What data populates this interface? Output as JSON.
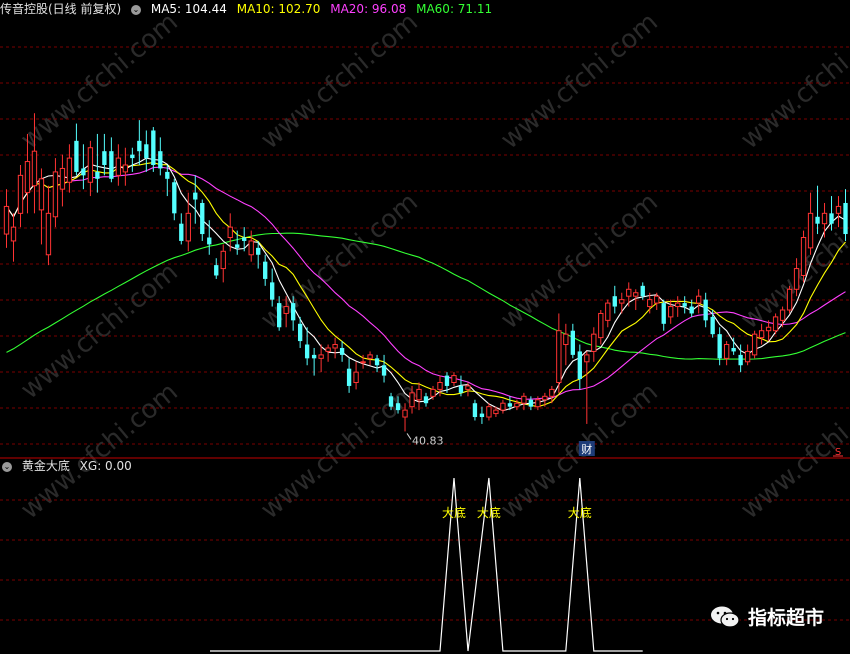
{
  "header": {
    "title": "传音控股(日线 前复权)",
    "ma5": "MA5: 104.44",
    "ma10": "MA10: 102.70",
    "ma20": "MA20: 96.08",
    "ma60": "MA60: 71.11",
    "colors": {
      "ma5": "#ffffff",
      "ma10": "#ffff00",
      "ma20": "#ff40ff",
      "ma60": "#33ff33"
    }
  },
  "sub_header": {
    "title": "黄金大底",
    "xg": "XG: 0.00"
  },
  "low_label": "40.83",
  "finance_marker": "财",
  "s_marker": "S",
  "signal_label": "大底",
  "brand": "指标超市",
  "watermark": "www.cfchi.com",
  "chart_data": [
    {
      "type": "candlestick",
      "ylim": [
        34,
        160
      ],
      "up_color": "#ff3333",
      "down_color": "#54ffff",
      "candles": [
        {
          "o": 98,
          "h": 111,
          "l": 94,
          "c": 106
        },
        {
          "o": 96,
          "h": 104,
          "l": 90,
          "c": 100
        },
        {
          "o": 104,
          "h": 118,
          "l": 100,
          "c": 115
        },
        {
          "o": 110,
          "h": 127,
          "l": 104,
          "c": 119
        },
        {
          "o": 112,
          "h": 133,
          "l": 104,
          "c": 122
        },
        {
          "o": 105,
          "h": 117,
          "l": 95,
          "c": 114
        },
        {
          "o": 92,
          "h": 112,
          "l": 89,
          "c": 104
        },
        {
          "o": 103,
          "h": 120,
          "l": 100,
          "c": 116
        },
        {
          "o": 111,
          "h": 121,
          "l": 106,
          "c": 117
        },
        {
          "o": 113,
          "h": 124,
          "l": 110,
          "c": 120
        },
        {
          "o": 125,
          "h": 130,
          "l": 115,
          "c": 116
        },
        {
          "o": 117,
          "h": 124,
          "l": 111,
          "c": 115
        },
        {
          "o": 113,
          "h": 125,
          "l": 109,
          "c": 123
        },
        {
          "o": 116,
          "h": 127,
          "l": 110,
          "c": 114
        },
        {
          "o": 122,
          "h": 127,
          "l": 115,
          "c": 118
        },
        {
          "o": 122,
          "h": 126,
          "l": 113,
          "c": 114
        },
        {
          "o": 115,
          "h": 124,
          "l": 112,
          "c": 120
        },
        {
          "o": 116,
          "h": 123,
          "l": 112,
          "c": 118
        },
        {
          "o": 121,
          "h": 123,
          "l": 116,
          "c": 120
        },
        {
          "o": 125,
          "h": 131,
          "l": 118,
          "c": 122
        },
        {
          "o": 124,
          "h": 128,
          "l": 116,
          "c": 120
        },
        {
          "o": 128,
          "h": 129,
          "l": 116,
          "c": 118
        },
        {
          "o": 122,
          "h": 126,
          "l": 115,
          "c": 117
        },
        {
          "o": 116,
          "h": 118,
          "l": 109,
          "c": 114
        },
        {
          "o": 113,
          "h": 114,
          "l": 102,
          "c": 104
        },
        {
          "o": 101,
          "h": 104,
          "l": 95,
          "c": 96
        },
        {
          "o": 96,
          "h": 110,
          "l": 93,
          "c": 104
        },
        {
          "o": 110,
          "h": 115,
          "l": 101,
          "c": 108
        },
        {
          "o": 107,
          "h": 108,
          "l": 96,
          "c": 98
        },
        {
          "o": 97,
          "h": 102,
          "l": 92,
          "c": 95
        },
        {
          "o": 89,
          "h": 91,
          "l": 85,
          "c": 86
        },
        {
          "o": 88,
          "h": 95,
          "l": 84,
          "c": 93
        },
        {
          "o": 97,
          "h": 104,
          "l": 93,
          "c": 100
        },
        {
          "o": 95,
          "h": 99,
          "l": 92,
          "c": 94
        },
        {
          "o": 97,
          "h": 100,
          "l": 93,
          "c": 96
        },
        {
          "o": 92,
          "h": 99,
          "l": 90,
          "c": 96
        },
        {
          "o": 94,
          "h": 96,
          "l": 88,
          "c": 92
        },
        {
          "o": 90,
          "h": 92,
          "l": 83,
          "c": 85
        },
        {
          "o": 84,
          "h": 88,
          "l": 77,
          "c": 79
        },
        {
          "o": 78,
          "h": 80,
          "l": 70,
          "c": 71
        },
        {
          "o": 75,
          "h": 80,
          "l": 71,
          "c": 77
        },
        {
          "o": 78,
          "h": 80,
          "l": 70,
          "c": 73
        },
        {
          "o": 72,
          "h": 74,
          "l": 65,
          "c": 67
        },
        {
          "o": 66,
          "h": 71,
          "l": 60,
          "c": 62
        },
        {
          "o": 63,
          "h": 65,
          "l": 57,
          "c": 62
        },
        {
          "o": 62,
          "h": 66,
          "l": 58,
          "c": 63
        },
        {
          "o": 64,
          "h": 66,
          "l": 61,
          "c": 65
        },
        {
          "o": 65,
          "h": 68,
          "l": 62,
          "c": 66
        },
        {
          "o": 65,
          "h": 67,
          "l": 61,
          "c": 63
        },
        {
          "o": 59,
          "h": 62,
          "l": 52,
          "c": 54
        },
        {
          "o": 55,
          "h": 61,
          "l": 53,
          "c": 58
        },
        {
          "o": 61,
          "h": 63,
          "l": 59,
          "c": 61
        },
        {
          "o": 62,
          "h": 64,
          "l": 60,
          "c": 63
        },
        {
          "o": 62,
          "h": 63,
          "l": 58,
          "c": 60
        },
        {
          "o": 60,
          "h": 63,
          "l": 55,
          "c": 57
        },
        {
          "o": 51,
          "h": 52,
          "l": 47,
          "c": 48
        },
        {
          "o": 49,
          "h": 51,
          "l": 46,
          "c": 47
        },
        {
          "o": 45,
          "h": 49,
          "l": 40.83,
          "c": 47
        },
        {
          "o": 48,
          "h": 54,
          "l": 46,
          "c": 52
        },
        {
          "o": 50,
          "h": 55,
          "l": 47,
          "c": 53
        },
        {
          "o": 51,
          "h": 52,
          "l": 48,
          "c": 49
        },
        {
          "o": 51,
          "h": 54,
          "l": 50,
          "c": 53
        },
        {
          "o": 53,
          "h": 57,
          "l": 51,
          "c": 55
        },
        {
          "o": 57,
          "h": 58,
          "l": 52,
          "c": 54
        },
        {
          "o": 55,
          "h": 58,
          "l": 54,
          "c": 57
        },
        {
          "o": 54,
          "h": 57,
          "l": 51,
          "c": 52
        },
        {
          "o": 53,
          "h": 55,
          "l": 51,
          "c": 54
        },
        {
          "o": 49,
          "h": 50,
          "l": 44,
          "c": 45
        },
        {
          "o": 46,
          "h": 48,
          "l": 43,
          "c": 45
        },
        {
          "o": 45,
          "h": 49,
          "l": 44,
          "c": 48
        },
        {
          "o": 46,
          "h": 48,
          "l": 45,
          "c": 47
        },
        {
          "o": 47,
          "h": 50,
          "l": 46,
          "c": 49
        },
        {
          "o": 49,
          "h": 51,
          "l": 47,
          "c": 48
        },
        {
          "o": 48,
          "h": 50,
          "l": 47,
          "c": 49
        },
        {
          "o": 49,
          "h": 52,
          "l": 47,
          "c": 51
        },
        {
          "o": 50,
          "h": 51,
          "l": 47,
          "c": 48
        },
        {
          "o": 48,
          "h": 51,
          "l": 47,
          "c": 50
        },
        {
          "o": 50,
          "h": 52,
          "l": 48,
          "c": 51
        },
        {
          "o": 51,
          "h": 54,
          "l": 49,
          "c": 53
        },
        {
          "o": 55,
          "h": 75,
          "l": 52,
          "c": 70
        },
        {
          "o": 66,
          "h": 72,
          "l": 60,
          "c": 69
        },
        {
          "o": 70,
          "h": 72,
          "l": 62,
          "c": 63
        },
        {
          "o": 64,
          "h": 66,
          "l": 53,
          "c": 56
        },
        {
          "o": 61,
          "h": 64,
          "l": 43,
          "c": 63
        },
        {
          "o": 64,
          "h": 71,
          "l": 61,
          "c": 69
        },
        {
          "o": 68,
          "h": 76,
          "l": 66,
          "c": 75
        },
        {
          "o": 73,
          "h": 79,
          "l": 71,
          "c": 78
        },
        {
          "o": 80,
          "h": 83,
          "l": 75,
          "c": 77
        },
        {
          "o": 78,
          "h": 81,
          "l": 75,
          "c": 79
        },
        {
          "o": 80,
          "h": 84,
          "l": 77,
          "c": 82
        },
        {
          "o": 80,
          "h": 82,
          "l": 76,
          "c": 81
        },
        {
          "o": 83,
          "h": 84,
          "l": 79,
          "c": 80
        },
        {
          "o": 77,
          "h": 81,
          "l": 75,
          "c": 79
        },
        {
          "o": 78,
          "h": 81,
          "l": 76,
          "c": 80
        },
        {
          "o": 78,
          "h": 79,
          "l": 70,
          "c": 72
        },
        {
          "o": 74,
          "h": 79,
          "l": 72,
          "c": 77
        },
        {
          "o": 77,
          "h": 80,
          "l": 74,
          "c": 78
        },
        {
          "o": 78,
          "h": 80,
          "l": 75,
          "c": 77
        },
        {
          "o": 77,
          "h": 79,
          "l": 74,
          "c": 75
        },
        {
          "o": 78,
          "h": 82,
          "l": 75,
          "c": 80
        },
        {
          "o": 79,
          "h": 81,
          "l": 71,
          "c": 73
        },
        {
          "o": 74,
          "h": 76,
          "l": 68,
          "c": 69
        },
        {
          "o": 69,
          "h": 71,
          "l": 60,
          "c": 62
        },
        {
          "o": 62,
          "h": 67,
          "l": 60,
          "c": 66
        },
        {
          "o": 65,
          "h": 68,
          "l": 63,
          "c": 64
        },
        {
          "o": 63,
          "h": 66,
          "l": 58,
          "c": 60
        },
        {
          "o": 61,
          "h": 66,
          "l": 60,
          "c": 64
        },
        {
          "o": 63,
          "h": 70,
          "l": 62,
          "c": 69
        },
        {
          "o": 68,
          "h": 72,
          "l": 66,
          "c": 70
        },
        {
          "o": 70,
          "h": 73,
          "l": 67,
          "c": 71
        },
        {
          "o": 70,
          "h": 75,
          "l": 69,
          "c": 74
        },
        {
          "o": 73,
          "h": 77,
          "l": 71,
          "c": 76
        },
        {
          "o": 76,
          "h": 83,
          "l": 75,
          "c": 82
        },
        {
          "o": 82,
          "h": 91,
          "l": 80,
          "c": 88
        },
        {
          "o": 86,
          "h": 99,
          "l": 84,
          "c": 97
        },
        {
          "o": 94,
          "h": 110,
          "l": 92,
          "c": 104
        },
        {
          "o": 103,
          "h": 112,
          "l": 98,
          "c": 101
        },
        {
          "o": 101,
          "h": 107,
          "l": 97,
          "c": 104
        },
        {
          "o": 104,
          "h": 109,
          "l": 99,
          "c": 101
        },
        {
          "o": 104,
          "h": 109,
          "l": 100,
          "c": 106
        },
        {
          "o": 107,
          "h": 111,
          "l": 96,
          "c": 98
        }
      ]
    },
    {
      "type": "line",
      "series": [
        {
          "name": "XG",
          "x": [
            0,
            62,
            64,
            66,
            69,
            71,
            73,
            80,
            82,
            84,
            91
          ],
          "values": [
            0,
            0,
            1,
            0,
            1,
            0,
            0,
            0,
            1,
            0,
            0
          ],
          "labels": [
            {
              "x": 64,
              "text": "大底"
            },
            {
              "x": 69,
              "text": "大底"
            },
            {
              "x": 82,
              "text": "大底"
            }
          ]
        }
      ],
      "ylim": [
        0,
        1
      ]
    }
  ]
}
